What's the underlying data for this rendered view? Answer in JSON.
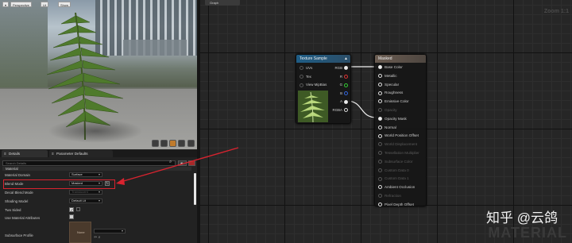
{
  "viewport": {
    "buttons": [
      "Perspective",
      "Lit",
      "Show"
    ]
  },
  "graph": {
    "tab_label": "Graph",
    "zoom_text": "Zoom 1:1",
    "watermark": "MATERIAL"
  },
  "texture_node": {
    "title": "Texture Sample",
    "inputs": [
      "UVs",
      "Tex",
      "View MipBias"
    ],
    "outputs": [
      "RGB",
      "R",
      "G",
      "B",
      "A",
      "RGBA"
    ]
  },
  "material_node": {
    "title": "Masked",
    "pins": [
      {
        "label": "Base Color",
        "state": "connected"
      },
      {
        "label": "Metallic",
        "state": "active"
      },
      {
        "label": "Specular",
        "state": "active"
      },
      {
        "label": "Roughness",
        "state": "active"
      },
      {
        "label": "Emissive Color",
        "state": "active"
      },
      {
        "label": "Opacity",
        "state": "disabled"
      },
      {
        "label": "Opacity Mask",
        "state": "connected"
      },
      {
        "label": "Normal",
        "state": "active"
      },
      {
        "label": "World Position Offset",
        "state": "active"
      },
      {
        "label": "World Displacement",
        "state": "disabled"
      },
      {
        "label": "Tessellation Multiplier",
        "state": "disabled"
      },
      {
        "label": "Subsurface Color",
        "state": "disabled"
      },
      {
        "label": "Custom Data 0",
        "state": "disabled"
      },
      {
        "label": "Custom Data 1",
        "state": "disabled"
      },
      {
        "label": "Ambient Occlusion",
        "state": "active"
      },
      {
        "label": "Refraction",
        "state": "disabled"
      },
      {
        "label": "Pixel Depth Offset",
        "state": "active"
      }
    ]
  },
  "details": {
    "tabs": [
      "Details",
      "Parameter Defaults"
    ],
    "search_placeholder": "Search Details",
    "section_title": "Material",
    "properties": [
      {
        "label": "Material Domain",
        "value": "Surface",
        "kind": "select"
      },
      {
        "label": "Blend Mode",
        "value": "Masked",
        "kind": "select"
      },
      {
        "label": "Decal Blend Mode",
        "value": "Translucent",
        "kind": "select-disabled"
      },
      {
        "label": "Shading Model",
        "value": "Default Lit",
        "kind": "select"
      },
      {
        "label": "Two Sided",
        "value": "",
        "kind": "checkbox"
      },
      {
        "label": "Use Material Attributes",
        "value": "",
        "kind": "checkbox"
      },
      {
        "label": "Subsurface Profile",
        "value": "None",
        "kind": "asset"
      }
    ]
  },
  "watermark_text": "知乎 @云鸽",
  "colors": {
    "highlight": "#d8232f",
    "texture_header": "#1f5d85",
    "material_header": "#6b5d52"
  }
}
